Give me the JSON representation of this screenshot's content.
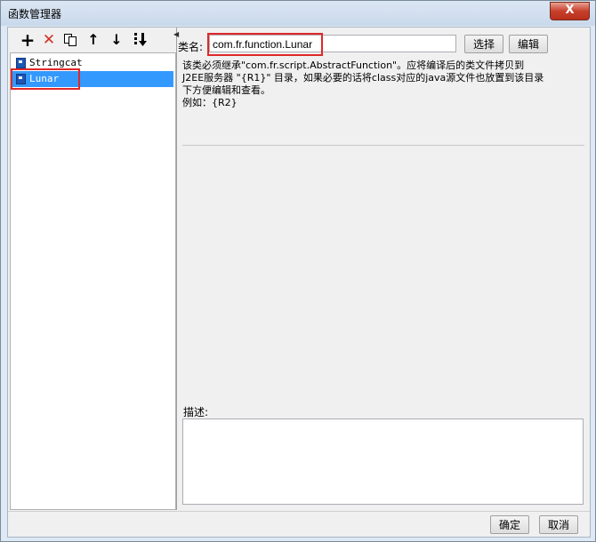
{
  "window": {
    "title": "函数管理器",
    "close_glyph": "X"
  },
  "toolbar": {
    "buttons": [
      {
        "icon": "plus-icon",
        "glyph": "+",
        "color": "#000000"
      },
      {
        "icon": "delete-icon",
        "glyph": "✕",
        "color": "#d83020"
      },
      {
        "icon": "copy-icon",
        "glyph": "",
        "color": "#000000"
      },
      {
        "icon": "arrow-up-icon",
        "glyph": "↑",
        "color": "#000000"
      },
      {
        "icon": "arrow-down-icon",
        "glyph": "↓",
        "color": "#000000"
      },
      {
        "icon": "sort-icon",
        "glyph": "",
        "color": "#000000"
      }
    ]
  },
  "list": {
    "items": [
      {
        "label": "Stringcat",
        "selected": false
      },
      {
        "label": "Lunar",
        "selected": true
      }
    ]
  },
  "form": {
    "class_label": "类名:",
    "class_value": "com.fr.function.Lunar",
    "select_button": "选择",
    "edit_button": "编辑",
    "info_lines": [
      "该类必须继承\"com.fr.script.AbstractFunction\"。应将编译后的类文件拷贝到",
      "J2EE服务器 \"{R1}\" 目录，如果必要的话将class对应的java源文件也放置到该目录",
      "下方便编辑和查看。",
      "例如：{R2}"
    ],
    "description_label": "描述:",
    "description_value": ""
  },
  "footer": {
    "ok_button": "确定",
    "cancel_button": "取消"
  },
  "colors": {
    "selection": "#3399ff",
    "highlight": "#e02828",
    "close_button": "#c7402c"
  }
}
